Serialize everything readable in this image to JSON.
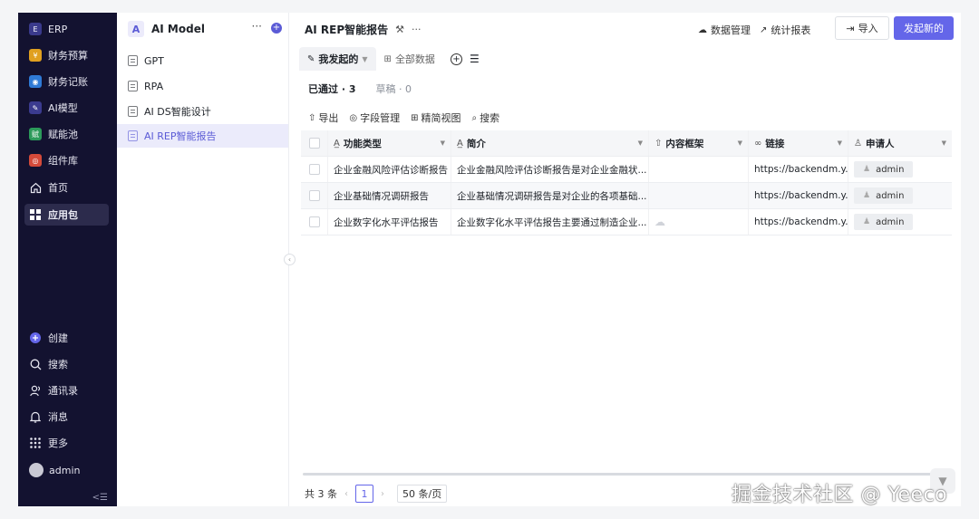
{
  "colors": {
    "nav_bg": "#131230",
    "accent": "#6466e9",
    "active_doc_bg": "#ebebfb"
  },
  "nav": {
    "apps": [
      {
        "label": "ERP",
        "icon": "erp-app-icon",
        "color": "#3a3a8c"
      },
      {
        "label": "财务预算",
        "icon": "budget-app-icon",
        "color": "#e0a020"
      },
      {
        "label": "财务记账",
        "icon": "ledger-app-icon",
        "color": "#2f7ad6"
      },
      {
        "label": "AI模型",
        "icon": "ai-model-app-icon",
        "color": "#3b3b8f"
      },
      {
        "label": "赋能池",
        "icon": "empower-app-icon",
        "color": "#2c9a5a"
      },
      {
        "label": "组件库",
        "icon": "components-app-icon",
        "color": "#d44a3a"
      },
      {
        "label": "首页",
        "icon": "home-icon"
      },
      {
        "label": "应用包",
        "icon": "grid-icon",
        "active": true
      }
    ],
    "bottom": [
      {
        "label": "创建",
        "icon": "plus-circle-icon"
      },
      {
        "label": "搜索",
        "icon": "search-icon"
      },
      {
        "label": "通讯录",
        "icon": "contacts-icon"
      },
      {
        "label": "消息",
        "icon": "bell-icon"
      },
      {
        "label": "更多",
        "icon": "dots-grid-icon"
      },
      {
        "label": "admin",
        "icon": "avatar"
      }
    ]
  },
  "side": {
    "logo_letter": "A",
    "title": "AI Model",
    "items": [
      {
        "label": "GPT"
      },
      {
        "label": "RPA"
      },
      {
        "label": "AI DS智能设计"
      },
      {
        "label": "AI REP智能报告",
        "active": true
      }
    ]
  },
  "main": {
    "title": "AI REP智能报告",
    "actions": {
      "data_manage": "数据管理",
      "stats": "统计报表",
      "import": "导入",
      "start": "发起新的"
    },
    "tabs": [
      {
        "label": "我发起的",
        "active": true
      },
      {
        "label": "全部数据"
      }
    ],
    "subtabs": [
      {
        "label": "已通过 · 3",
        "active": true
      },
      {
        "label": "草稿 · 0"
      }
    ],
    "toolbar": [
      "导出",
      "字段管理",
      "精简视图",
      "搜索"
    ]
  },
  "table": {
    "columns": [
      "功能类型",
      "简介",
      "内容框架",
      "链接",
      "申请人"
    ],
    "rows": [
      [
        "企业金融风险评估诊断报告",
        "企业金融风险评估诊断报告是对企业金融状...",
        "",
        "https://backendm.y...",
        "admin"
      ],
      [
        "企业基础情况调研报告",
        "企业基础情况调研报告是对企业的各项基础...",
        "",
        "https://backendm.y...",
        "admin"
      ],
      [
        "企业数字化水平评估报告",
        "企业数字化水平评估报告主要通过制造企业...",
        "",
        "https://backendm.y...",
        "admin"
      ]
    ]
  },
  "pager": {
    "total": "共 3 条",
    "current_page": "1",
    "page_size": "50 条/页"
  },
  "watermark": "掘金技术社区 @ Yeeco"
}
